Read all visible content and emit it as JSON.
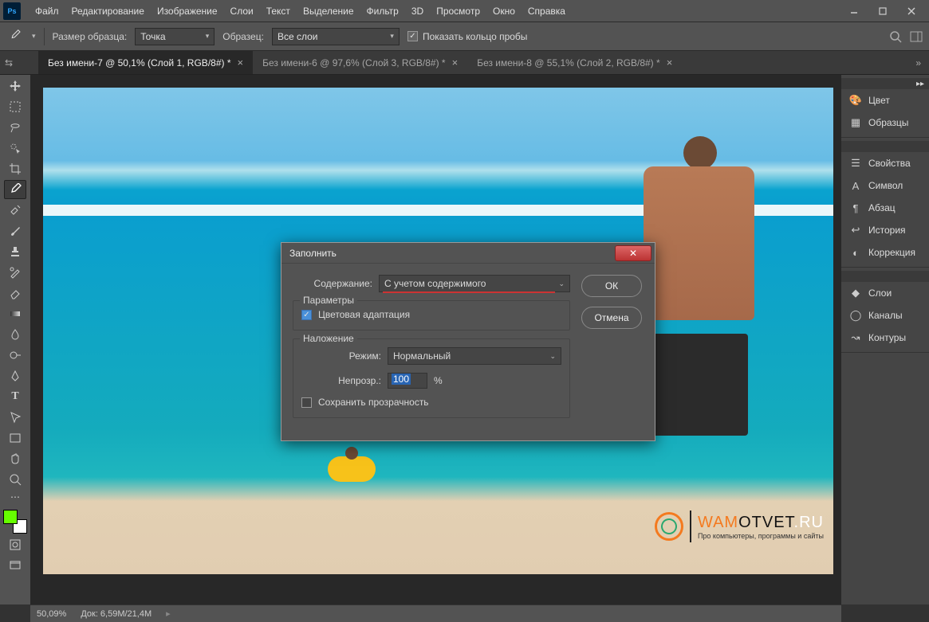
{
  "menu": [
    "Файл",
    "Редактирование",
    "Изображение",
    "Слои",
    "Текст",
    "Выделение",
    "Фильтр",
    "3D",
    "Просмотр",
    "Окно",
    "Справка"
  ],
  "options": {
    "sample_label": "Размер образца:",
    "sample_value": "Точка",
    "sample2_label": "Образец:",
    "sample2_value": "Все слои",
    "show_ring": "Показать кольцо пробы"
  },
  "tabs": [
    {
      "label": "Без имени-7 @ 50,1% (Слой 1, RGB/8#) *",
      "active": true
    },
    {
      "label": "Без имени-6 @ 97,6% (Слой 3, RGB/8#) *",
      "active": false
    },
    {
      "label": "Без имени-8 @ 55,1% (Слой 2, RGB/8#) *",
      "active": false
    }
  ],
  "dialog": {
    "title": "Заполнить",
    "content_label": "Содержание:",
    "content_value": "С учетом содержимого",
    "params_legend": "Параметры",
    "color_adapt": "Цветовая адаптация",
    "blend_legend": "Наложение",
    "mode_label": "Режим:",
    "mode_value": "Нормальный",
    "opacity_label": "Непрозр.:",
    "opacity_value": "100",
    "opacity_pct": "%",
    "preserve": "Сохранить прозрачность",
    "ok": "ОК",
    "cancel": "Отмена"
  },
  "panels": {
    "g1": [
      {
        "icon": "palette",
        "label": "Цвет"
      },
      {
        "icon": "grid",
        "label": "Образцы"
      }
    ],
    "g2": [
      {
        "icon": "sliders",
        "label": "Свойства"
      },
      {
        "icon": "A",
        "label": "Символ"
      },
      {
        "icon": "para",
        "label": "Абзац"
      },
      {
        "icon": "history",
        "label": "История"
      },
      {
        "icon": "adjust",
        "label": "Коррекция"
      }
    ],
    "g3": [
      {
        "icon": "layers",
        "label": "Слои"
      },
      {
        "icon": "channels",
        "label": "Каналы"
      },
      {
        "icon": "paths",
        "label": "Контуры"
      }
    ]
  },
  "status": {
    "zoom": "50,09%",
    "doc": "Док: 6,59M/21,4M"
  },
  "watermark": {
    "line1a": "WAM",
    "line1b": "OTVET",
    "line1c": ".RU",
    "line2": "Про компьютеры, программы и сайты"
  }
}
